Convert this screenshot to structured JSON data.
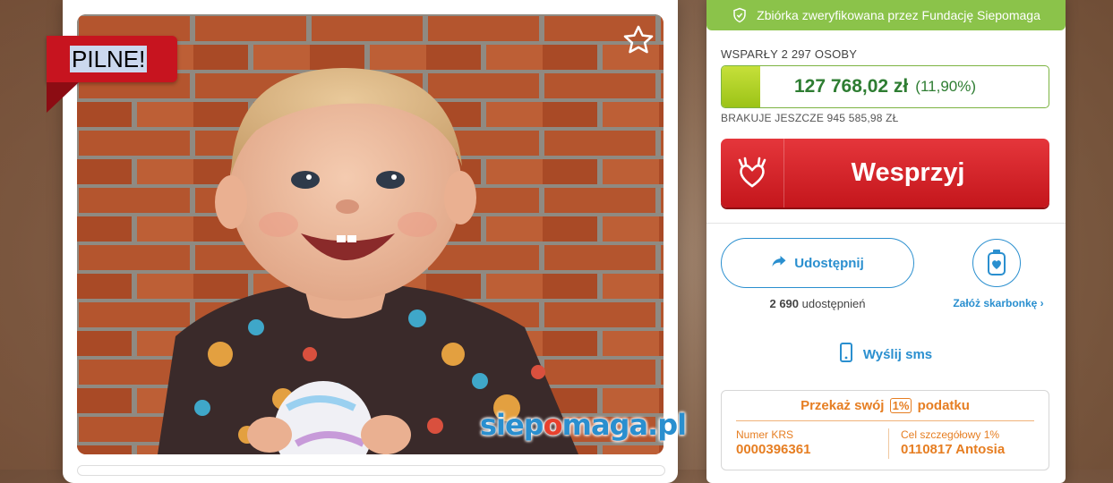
{
  "badge": {
    "label": "PILNE!"
  },
  "watermark": {
    "part1": "siep",
    "part2": "o",
    "part3": "maga.pl"
  },
  "verified": {
    "text": "Zbiórka zweryfikowana przez Fundację Siepomaga",
    "icon": "shield-check-icon"
  },
  "progress": {
    "supporters": "WSPARŁY 2 297 OSOBY",
    "amount": "127 768,02 zł",
    "percent_text": "(11,90%)",
    "percent_value": 11.9,
    "missing": "BRAKUJE JESZCZE 945 585,98 ZŁ"
  },
  "donate": {
    "label": "Wesprzyj",
    "icon": "heart-hands-icon"
  },
  "share": {
    "label": "Udostępnij",
    "count": "2 690",
    "count_label": "udostępnień",
    "icon": "share-arrow-icon"
  },
  "piggy": {
    "label": "Załóż skarbonkę ›",
    "icon": "piggy-bank-icon"
  },
  "sms": {
    "label": "Wyślij sms",
    "icon": "phone-icon"
  },
  "tax": {
    "title_before": "Przekaż swój",
    "title_pct": "1%",
    "title_after": "podatku",
    "krs_label": "Numer KRS",
    "krs_value": "0000396361",
    "goal_label": "Cel szczegółowy 1%",
    "goal_value": "0110817 Antosia"
  },
  "colors": {
    "green": "#8bc34a",
    "red": "#c4161c",
    "blue": "#2a8fcf",
    "orange": "#e67e22"
  }
}
